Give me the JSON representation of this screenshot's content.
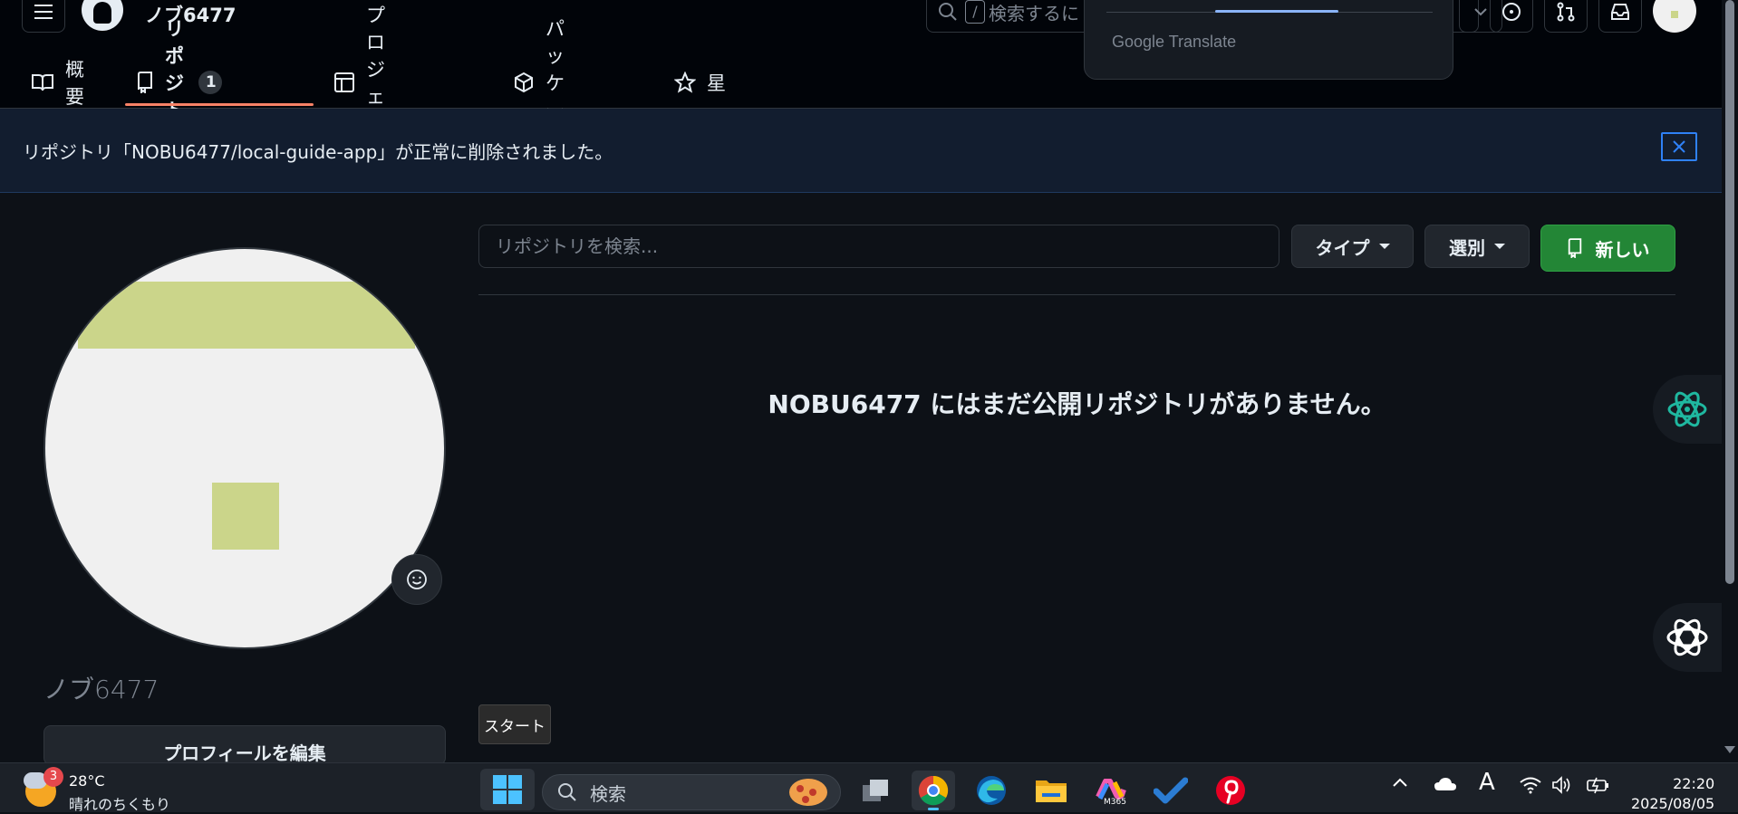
{
  "header": {
    "username": "ノブ6477",
    "search_placeholder": "検索するに",
    "search_slash": "/",
    "translate_popup_brand": "Google Translate"
  },
  "tabs": [
    {
      "label": "概要",
      "icon": "book-icon"
    },
    {
      "label": "リポジトリ",
      "icon": "repo-icon",
      "count": "1",
      "active": true
    },
    {
      "label": "プロジェクト",
      "icon": "table-icon"
    },
    {
      "label": "パッケージ",
      "icon": "package-icon"
    },
    {
      "label": "星",
      "icon": "star-icon"
    }
  ],
  "flash": {
    "message": "リポジトリ「NOBU6477/local-guide-app」が正常に削除されました。"
  },
  "profile": {
    "display_name": "ノブ6477",
    "edit_button": "プロフィールを編集"
  },
  "repos": {
    "search_placeholder": "リポジトリを検索...",
    "type_button": "タイプ",
    "sort_button": "選別",
    "new_button": "新しい",
    "empty_message": "NOBU6477 にはまだ公開リポジトリがありません。"
  },
  "tooltip": {
    "text": "スタート"
  },
  "taskbar": {
    "weather_badge": "3",
    "temperature": "28°C",
    "weather_condition": "晴れのちくもり",
    "search_label": "検索",
    "apps": [
      "task-view",
      "chrome",
      "edge",
      "file-explorer",
      "microsoft-365",
      "todo",
      "pinterest"
    ],
    "m365_label": "M365",
    "ime_label": "A",
    "time": "22:20",
    "date": "2025/08/05"
  },
  "colors": {
    "background": "#0d1117",
    "header_bg": "#010409",
    "accent_underline": "#f78166",
    "new_button": "#238636",
    "flash_bg": "#121d2f",
    "avatar_block": "#cbd58a"
  }
}
